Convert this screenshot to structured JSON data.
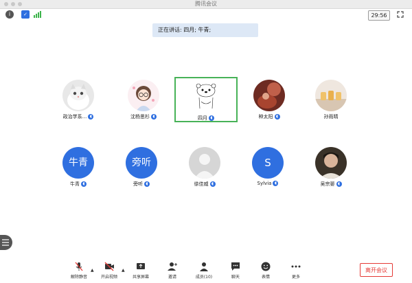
{
  "window": {
    "title": "腾讯会议"
  },
  "topbar": {
    "timer": "29:56"
  },
  "speaking": {
    "text": "正在讲话: 四月; 牛青;"
  },
  "participants": [
    {
      "name": "政治学系...",
      "avatar": "photo-cat",
      "avatar_text": ""
    },
    {
      "name": "沈杨思杉",
      "avatar": "photo-cartoon-girl",
      "avatar_text": ""
    },
    {
      "name": "四月",
      "avatar": "photo-bear",
      "avatar_text": "",
      "active": true
    },
    {
      "name": "种太阳",
      "avatar": "photo-orange",
      "avatar_text": ""
    },
    {
      "name": "孙雨晴",
      "avatar": "photo-cups",
      "avatar_text": ""
    },
    {
      "name": "牛青",
      "avatar": "text",
      "avatar_text": "牛青"
    },
    {
      "name": "旁听",
      "avatar": "text",
      "avatar_text": "旁听"
    },
    {
      "name": "徐佳威",
      "avatar": "default-person",
      "avatar_text": ""
    },
    {
      "name": "Sylvia",
      "avatar": "letter",
      "avatar_text": "S"
    },
    {
      "name": "吴宗晏",
      "avatar": "photo-person",
      "avatar_text": ""
    }
  ],
  "toolbar": {
    "unmute": "解除静音",
    "start_video": "开启视频",
    "share_screen": "共享屏幕",
    "invite": "邀请",
    "members": "成员(10)",
    "chat": "聊天",
    "reactions": "表情",
    "more": "更多",
    "leave": "离开会议"
  },
  "colors": {
    "accent": "#2f6fe0",
    "active_border": "#47b257",
    "leave": "#e53935"
  }
}
